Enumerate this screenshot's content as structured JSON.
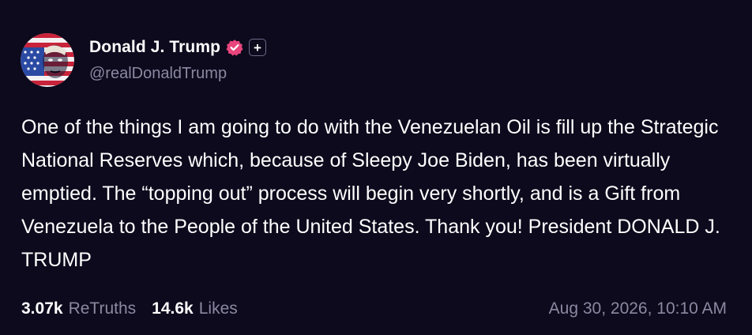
{
  "post": {
    "author": {
      "display_name": "Donald J. Trump",
      "handle": "@realDonaldTrump",
      "verified": true,
      "verified_badge_icon": "verified-check-icon",
      "verified_color": "#e8457c",
      "plus_badge_icon": "plus-icon",
      "plus_badge_symbol": "+",
      "avatar_icon": "flag-face-avatar"
    },
    "text": "One of the things I am going to do with the Venezuelan Oil is fill up the Strategic National Reserves which, because of Sleepy Joe Biden, has been virtually emptied. The “topping out” process will begin very shortly, and is a Gift from Venezuela to the People of the United States. Thank you! President DONALD J. TRUMP",
    "stats": {
      "retruths_count": "3.07k",
      "retruths_label": "ReTruths",
      "likes_count": "14.6k",
      "likes_label": "Likes"
    },
    "timestamp": "Aug 30, 2026, 10:10 AM"
  },
  "colors": {
    "background": "#0c0a1c",
    "primary_text": "#ffffff",
    "secondary_text": "#8c88a2"
  }
}
